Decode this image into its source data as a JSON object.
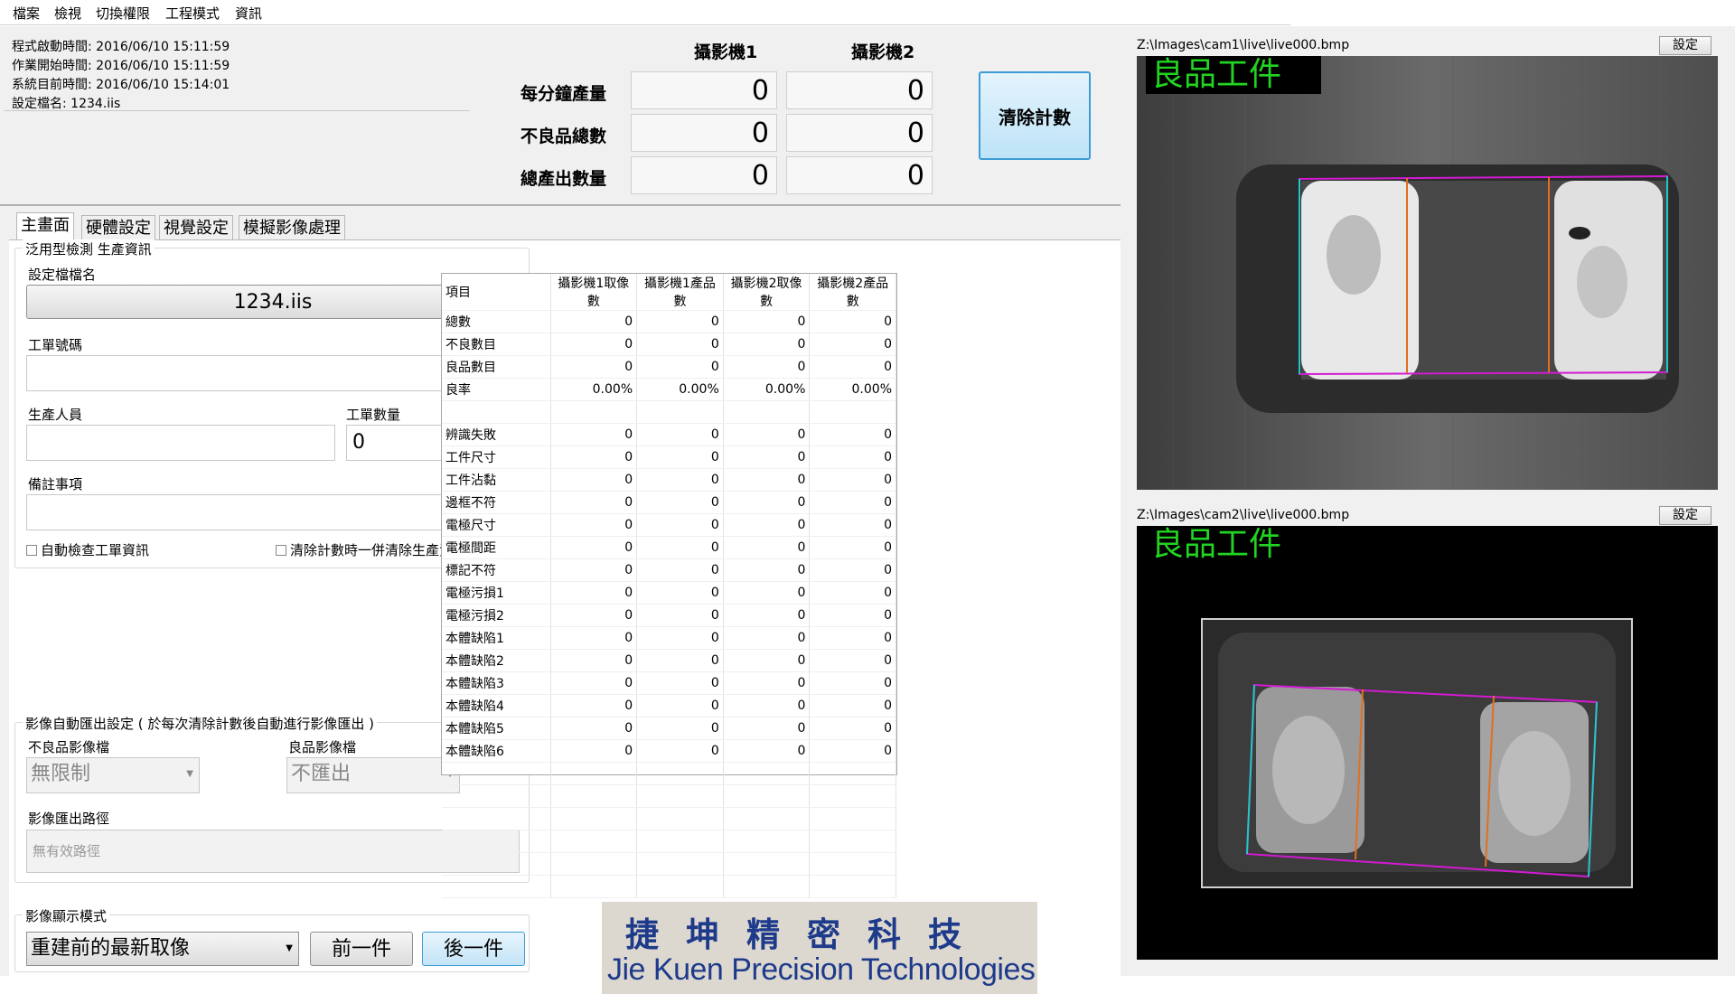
{
  "menu": [
    "檔案",
    "檢視",
    "切換權限",
    "工程模式",
    "資訊"
  ],
  "info": {
    "start_time": "程式啟動時間: 2016/06/10 15:11:59",
    "work_start": "作業開始時間: 2016/06/10 15:11:59",
    "sys_time": "系統目前時間: 2016/06/10 15:14:01",
    "config_name": "設定檔名: 1234.iis"
  },
  "counters": {
    "cam1_header": "攝影機1",
    "cam2_header": "攝影機2",
    "rows": [
      {
        "label": "每分鐘產量",
        "cam1": "0",
        "cam2": "0"
      },
      {
        "label": "不良品總數",
        "cam1": "0",
        "cam2": "0"
      },
      {
        "label": "總產出數量",
        "cam1": "0",
        "cam2": "0"
      }
    ],
    "clear_button": "清除計數"
  },
  "tabs": [
    "主畫面",
    "硬體設定",
    "視覺設定",
    "模擬影像處理"
  ],
  "production": {
    "group_title": "泛用型檢測 生產資訊",
    "config_label": "設定檔檔名",
    "config_value": "1234.iis",
    "order_label": "工單號碼",
    "order_value": "",
    "operator_label": "生產人員",
    "operator_value": "",
    "qty_label": "工單數量",
    "qty_value": "0",
    "notes_label": "備註事項",
    "notes_value": "",
    "auto_check": "自動檢查工單資訊",
    "clear_with_count": "清除計數時一併清除生產資訊"
  },
  "export": {
    "group_title": "影像自動匯出設定 ( 於每次清除計數後自動進行影像匯出 )",
    "ng_label": "不良品影像檔",
    "ng_value": "無限制",
    "ok_label": "良品影像檔",
    "ok_value": "不匯出",
    "path_label": "影像匯出路徑",
    "path_value": "無有效路徑"
  },
  "display": {
    "group_title": "影像顯示模式",
    "mode_value": "重建前的最新取像",
    "prev_button": "前一件",
    "next_button": "後一件"
  },
  "stats": {
    "headers": [
      "項目",
      "攝影機1取像數",
      "攝影機1產品數",
      "攝影機2取像數",
      "攝影機2產品數"
    ],
    "rows": [
      [
        "總數",
        "0",
        "0",
        "0",
        "0"
      ],
      [
        "不良數目",
        "0",
        "0",
        "0",
        "0"
      ],
      [
        "良品數目",
        "0",
        "0",
        "0",
        "0"
      ],
      [
        "良率",
        "0.00%",
        "0.00%",
        "0.00%",
        "0.00%"
      ],
      [
        "",
        "",
        "",
        "",
        ""
      ],
      [
        "辨識失敗",
        "0",
        "0",
        "0",
        "0"
      ],
      [
        "工件尺寸",
        "0",
        "0",
        "0",
        "0"
      ],
      [
        "工件沾黏",
        "0",
        "0",
        "0",
        "0"
      ],
      [
        "邊框不符",
        "0",
        "0",
        "0",
        "0"
      ],
      [
        "電極尺寸",
        "0",
        "0",
        "0",
        "0"
      ],
      [
        "電極間距",
        "0",
        "0",
        "0",
        "0"
      ],
      [
        "標記不符",
        "0",
        "0",
        "0",
        "0"
      ],
      [
        "電極污損1",
        "0",
        "0",
        "0",
        "0"
      ],
      [
        "電極污損2",
        "0",
        "0",
        "0",
        "0"
      ],
      [
        "本體缺陷1",
        "0",
        "0",
        "0",
        "0"
      ],
      [
        "本體缺陷2",
        "0",
        "0",
        "0",
        "0"
      ],
      [
        "本體缺陷3",
        "0",
        "0",
        "0",
        "0"
      ],
      [
        "本體缺陷4",
        "0",
        "0",
        "0",
        "0"
      ],
      [
        "本體缺陷5",
        "0",
        "0",
        "0",
        "0"
      ],
      [
        "本體缺陷6",
        "0",
        "0",
        "0",
        "0"
      ],
      [
        "",
        "",
        "",
        "",
        ""
      ],
      [
        "",
        "",
        "",
        "",
        ""
      ],
      [
        "",
        "",
        "",
        "",
        ""
      ],
      [
        "",
        "",
        "",
        "",
        ""
      ],
      [
        "",
        "",
        "",
        "",
        ""
      ],
      [
        "",
        "",
        "",
        "",
        ""
      ]
    ]
  },
  "logo": {
    "chinese": "捷坤精密科技",
    "english": "Jie Kuen Precision Technologies"
  },
  "cameras": [
    {
      "path": "Z:\\Images\\cam1\\live\\live000.bmp",
      "settings_button": "設定",
      "result": "良品工件"
    },
    {
      "path": "Z:\\Images\\cam2\\live\\live000.bmp",
      "settings_button": "設定",
      "result": "良品工件"
    }
  ]
}
